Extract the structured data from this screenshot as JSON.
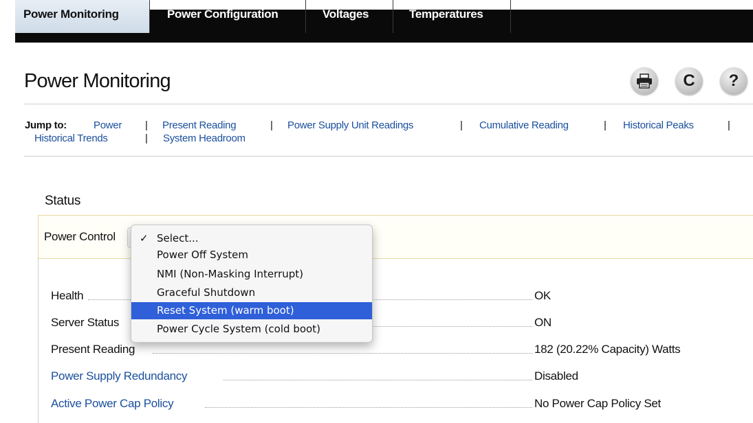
{
  "tabs": [
    {
      "label": "Power Monitoring",
      "active": true
    },
    {
      "label": "Power Configuration",
      "active": false
    },
    {
      "label": "Voltages",
      "active": false
    },
    {
      "label": "Temperatures",
      "active": false
    }
  ],
  "header": {
    "title": "Power Monitoring",
    "icons": [
      "print-icon",
      "refresh-icon",
      "help-icon"
    ],
    "refresh_glyph": "C",
    "help_glyph": "?"
  },
  "jump": {
    "label": "Jump to:",
    "separator": "|",
    "links": [
      "Power",
      "Present Reading",
      "Power Supply Unit Readings",
      "Cumulative Reading",
      "Historical Peaks",
      "Historical Trends",
      "System Headroom"
    ]
  },
  "status": {
    "title": "Status",
    "power_control_label": "Power Control",
    "menu": {
      "items": [
        "Select...",
        "Power Off System",
        "NMI (Non-Masking Interrupt)",
        "Graceful Shutdown",
        "Reset System (warm boot)",
        "Power Cycle System (cold boot)"
      ],
      "checked": "Select...",
      "highlighted": "Reset System (warm boot)",
      "check_glyph": "✓"
    },
    "rows": [
      {
        "label": "Health",
        "value": "OK",
        "link": false
      },
      {
        "label": "Server Status",
        "value": "ON",
        "link": false
      },
      {
        "label": "Present Reading",
        "value": "182 (20.22% Capacity) Watts",
        "link": false
      },
      {
        "label": "Power Supply Redundancy",
        "value": "Disabled",
        "link": true
      },
      {
        "label": "Active Power Cap Policy",
        "value": "No Power Cap Policy Set",
        "link": true
      }
    ]
  },
  "colors": {
    "link": "#1a4f9c",
    "tabbar": "#0a0a0a",
    "active_tab": "#dbe5f0",
    "menu_highlight": "#2f5fd9",
    "status_box_border": "#e8d9a0"
  }
}
